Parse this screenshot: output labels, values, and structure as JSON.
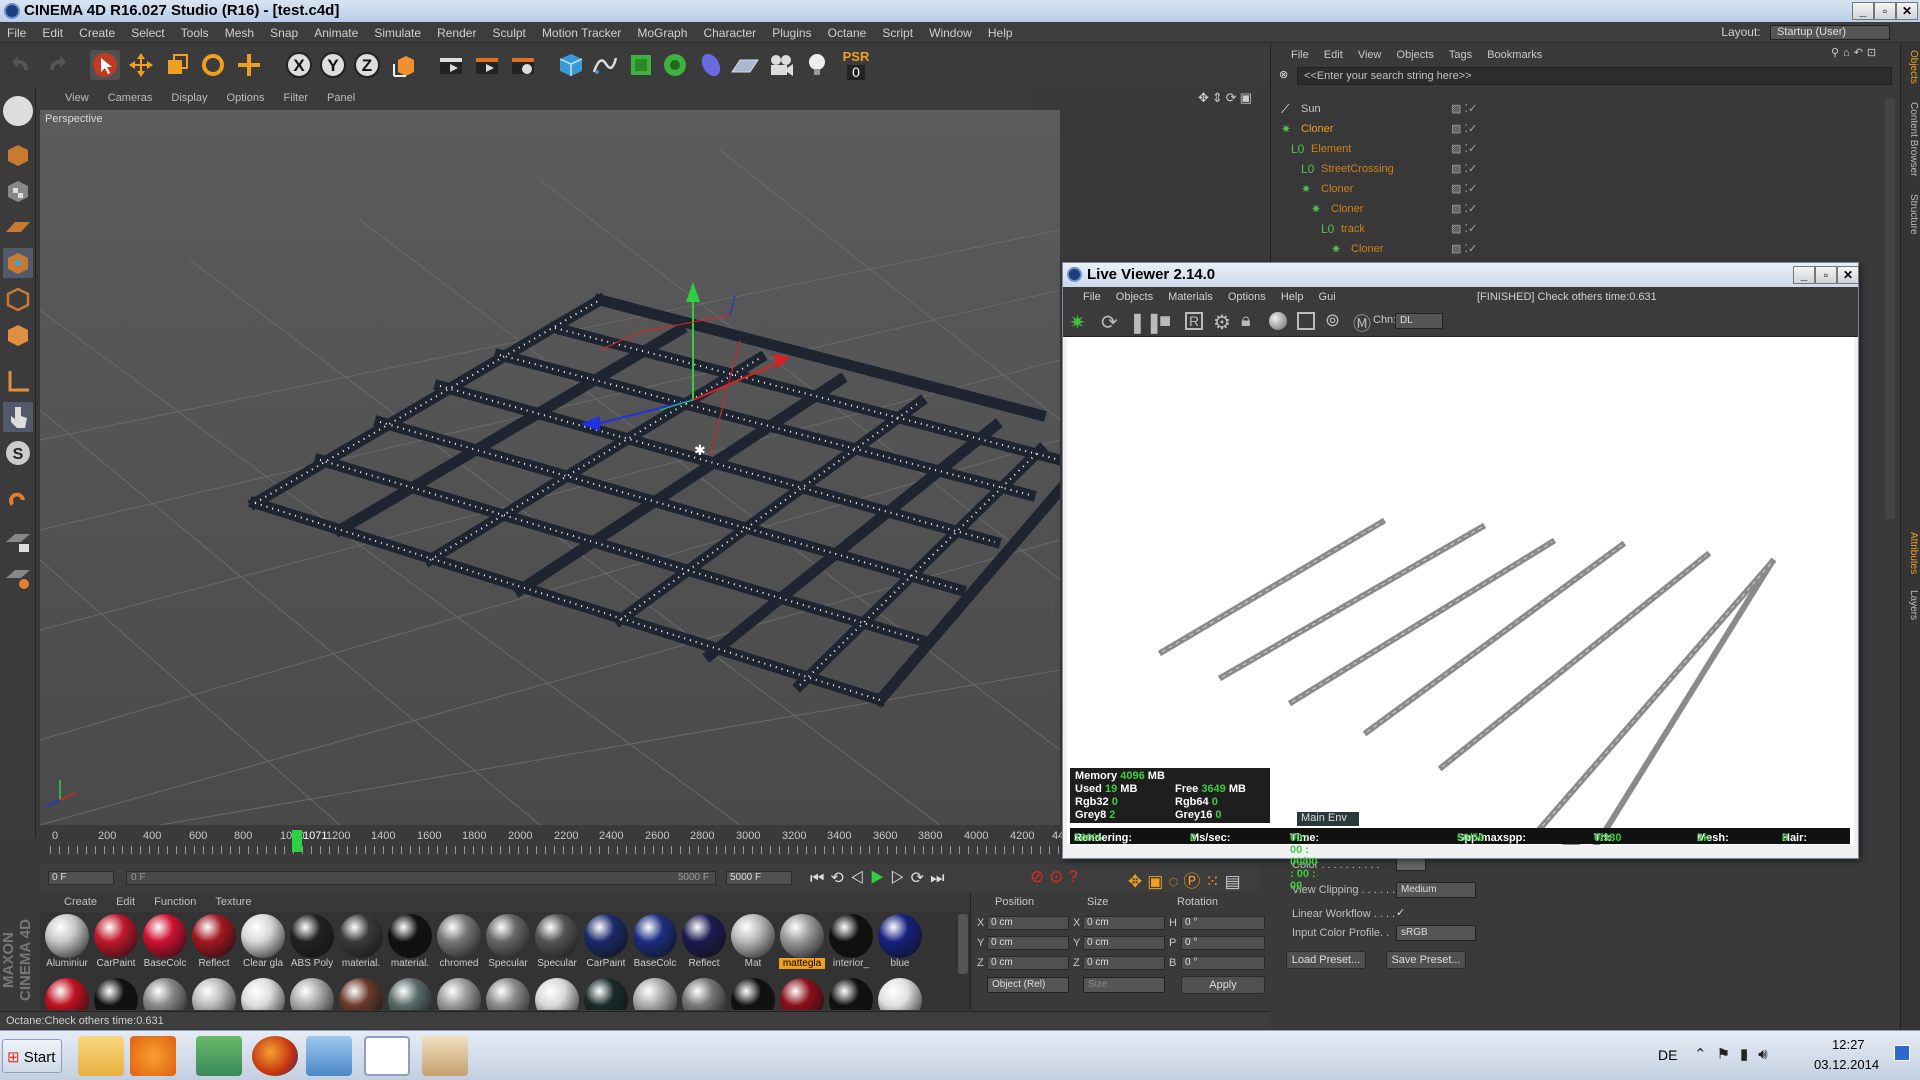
{
  "window": {
    "title": "CINEMA 4D R16.027 Studio (R16) - [test.c4d]"
  },
  "menu": [
    "File",
    "Edit",
    "Create",
    "Select",
    "Tools",
    "Mesh",
    "Snap",
    "Animate",
    "Simulate",
    "Render",
    "Sculpt",
    "Motion Tracker",
    "MoGraph",
    "Character",
    "Plugins",
    "Octane",
    "Script",
    "Window",
    "Help"
  ],
  "layout": {
    "label": "Layout:",
    "value": "Startup (User)"
  },
  "toolbar": {
    "psr_label": "PSR",
    "psr_value": "0"
  },
  "viewport": {
    "menu": [
      "View",
      "Cameras",
      "Display",
      "Options",
      "Filter",
      "Panel"
    ],
    "label": "Perspective"
  },
  "timeline": {
    "ticks": [
      "0",
      "200",
      "400",
      "600",
      "800",
      "1000",
      "1200",
      "1400",
      "1600",
      "1800",
      "2000",
      "2200",
      "2400",
      "2600",
      "2800",
      "3000",
      "3200",
      "3400",
      "3600",
      "3800",
      "4000",
      "4200",
      "4400"
    ],
    "current": "1071",
    "frame_field": "0 F",
    "range_start": "0 F",
    "range_end": "5000 F",
    "end_field": "5000 F"
  },
  "materials": {
    "menu": [
      "Create",
      "Edit",
      "Function",
      "Texture"
    ],
    "row1": [
      {
        "name": "Aluminiur",
        "color": "#c8c8c8"
      },
      {
        "name": "CarPaint",
        "color": "#c0182a"
      },
      {
        "name": "BaseColc",
        "color": "#d01030"
      },
      {
        "name": "Reflect",
        "color": "#a01820"
      },
      {
        "name": "Clear gla",
        "color": "#d8d8d8"
      },
      {
        "name": "ABS Poly",
        "color": "#222222"
      },
      {
        "name": "material.",
        "color": "#3a3a3a"
      },
      {
        "name": "material.",
        "color": "#111111"
      },
      {
        "name": "chromed",
        "color": "#777777"
      },
      {
        "name": "Specular",
        "color": "#666666"
      },
      {
        "name": "Specular",
        "color": "#555555"
      },
      {
        "name": "CarPaint",
        "color": "#1a2a6a"
      },
      {
        "name": "BaseColc",
        "color": "#1c2e80"
      },
      {
        "name": "Reflect",
        "color": "#1a1a50"
      },
      {
        "name": "Mat",
        "color": "#b8b8b8"
      },
      {
        "name": "mattegla",
        "color": "#9a9a9a"
      },
      {
        "name": "interior_",
        "color": "#101010"
      },
      {
        "name": "blue",
        "color": "#142080"
      }
    ],
    "row2_colors": [
      "#c01020",
      "#111111",
      "#888888",
      "#bbbbbb",
      "#dddddd",
      "#aaaaaa",
      "#6a3a2a",
      "#5a6a6a",
      "#999999",
      "#8a8a8a",
      "#d8d8d8",
      "#1a2a2a",
      "#aaaaaa",
      "#777777",
      "#111111",
      "#8a1018",
      "#101010",
      "#e0e0e0"
    ]
  },
  "coords": {
    "headers": [
      "Position",
      "Size",
      "Rotation"
    ],
    "rows": [
      {
        "axis": "X",
        "pos": "0 cm",
        "size": "0 cm",
        "rlabel": "H",
        "rot": "0 °"
      },
      {
        "axis": "Y",
        "pos": "0 cm",
        "size": "0 cm",
        "rlabel": "P",
        "rot": "0 °"
      },
      {
        "axis": "Z",
        "pos": "0 cm",
        "size": "0 cm",
        "rlabel": "B",
        "rot": "0 °"
      }
    ],
    "mode": "Object (Rel)",
    "size_mode": "Size",
    "apply": "Apply"
  },
  "status": "Octane:Check others time:0.631",
  "object_manager": {
    "menu": [
      "File",
      "Edit",
      "View",
      "Objects",
      "Tags",
      "Bookmarks"
    ],
    "search_placeholder": "<<Enter your search string here>>",
    "rows": [
      {
        "name": "Sun",
        "color": "#c8c8c8",
        "indent": 0
      },
      {
        "name": "Cloner",
        "color": "#e8a020",
        "indent": 0
      },
      {
        "name": "Element",
        "color": "#d08018",
        "indent": 1
      },
      {
        "name": "StreetCrossing",
        "color": "#d08018",
        "indent": 2
      },
      {
        "name": "Cloner",
        "color": "#d08018",
        "indent": 2
      },
      {
        "name": "Cloner",
        "color": "#d08018",
        "indent": 3
      },
      {
        "name": "track",
        "color": "#d08018",
        "indent": 4
      },
      {
        "name": "Cloner",
        "color": "#d08018",
        "indent": 5
      }
    ]
  },
  "side_tabs": [
    "Objects",
    "Content Browser",
    "Structure",
    "Attributes",
    "Layers"
  ],
  "attributes": {
    "color_label": "Color . . . . . . . . . .",
    "view_clipping_label": "View Clipping . . . . . .",
    "view_clipping_value": "Medium",
    "linear_workflow_label": "Linear Workflow . . . .",
    "input_color_label": "Input Color Profile. .",
    "input_color_value": "sRGB",
    "load_preset": "Load Preset...",
    "save_preset": "Save Preset..."
  },
  "live_viewer": {
    "title": "Live Viewer 2.14.0",
    "menu": [
      "File",
      "Objects",
      "Materials",
      "Options",
      "Help",
      "Gui"
    ],
    "status": "[FINISHED] Check others time:0.631",
    "channel_label": "Chn:",
    "channel_value": "DL",
    "tabs": [
      "Main",
      "Env"
    ],
    "stats": {
      "memory_label": "Memory",
      "memory_value": "4096",
      "memory_unit": "MB",
      "used_label": "Used",
      "used_value": "19",
      "used_unit": "MB",
      "free_label": "Free",
      "free_value": "3649",
      "free_unit": "MB",
      "rgb32_label": "Rgb32",
      "rgb32_value": "0",
      "rgb64_label": "Rgb64",
      "rgb64_value": "0",
      "grey8_label": "Grey8",
      "grey8_value": "2",
      "grey16_label": "Grey16",
      "grey16_value": "0"
    },
    "bar": {
      "rendering_label": "Rendering:",
      "rendering_value": "100%",
      "mssec_label": "Ms/sec:",
      "mssec_value": "0",
      "time_label": "Time:",
      "time_value": "00 : 00 : 00/00 : 00 : 00",
      "spp_label": "Spp/maxspp:",
      "spp_value": "50/50",
      "tri_label": "Tri:",
      "tri_value": "0/980",
      "mesh_label": "Mesh:",
      "mesh_value": "2k",
      "hair_label": "Hair:",
      "hair_value": "0"
    }
  },
  "taskbar": {
    "start": "Start",
    "lang": "DE",
    "time": "12:27",
    "date": "03.12.2014"
  }
}
